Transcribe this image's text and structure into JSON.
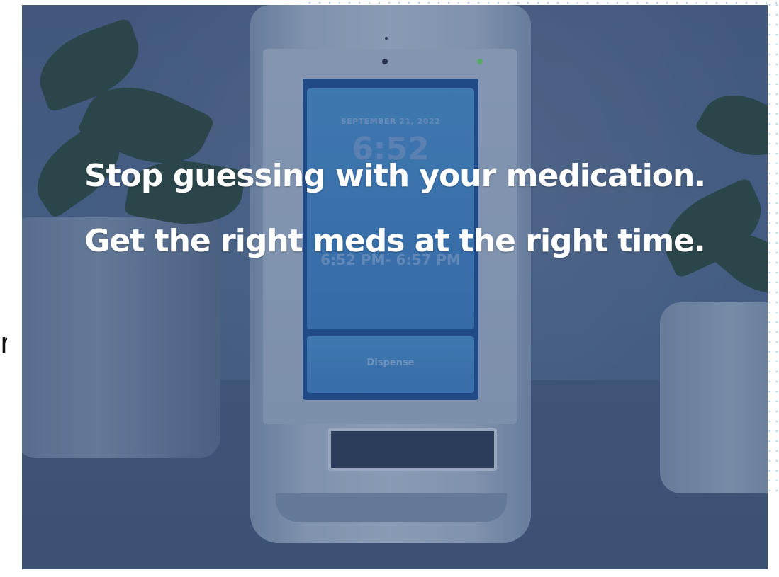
{
  "hero": {
    "headline": "Stop guessing with your medication. Get the right meds at the right time.",
    "overlay_color": "#3c5c8c"
  },
  "device_screen": {
    "date": "SEPTEMBER 21, 2022",
    "time": "6:52",
    "dispense_window": "6:52 PM- 6:57 PM",
    "button_label": "Dispense",
    "led_color": "#6fd36a"
  },
  "decor": {
    "left_edge_glyph": "r"
  }
}
